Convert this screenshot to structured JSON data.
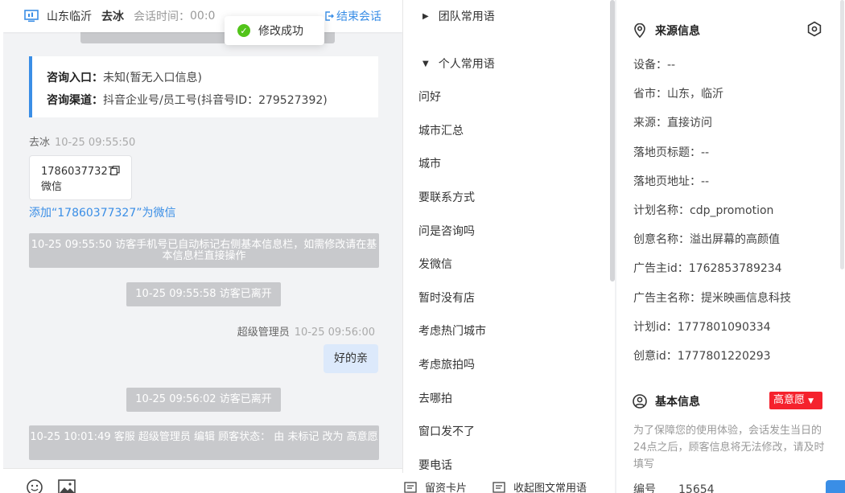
{
  "chat": {
    "header": {
      "location": "山东临沂",
      "visitor_name": "去冰",
      "timer_label": "会话时间：",
      "timer_value": "00:0",
      "end_label": "结束会话"
    },
    "toast": "修改成功",
    "entry_card": {
      "entry_label": "咨询入口：",
      "entry_value": "未知(暂无入口信息)",
      "channel_label": "咨询渠道：",
      "channel_value": "抖音企业号/员工号(抖音号ID：279527392)"
    },
    "message1": {
      "sender": "去冰",
      "time": "10-25 09:55:50",
      "phone": "17860377327",
      "type": "微信",
      "add_link": "添加“17860377327”为微信"
    },
    "system_messages": [
      "10-25 09:55:50 访客手机号已自动标记右侧基本信息栏，如需修改请在基本信息栏直接操作",
      "10-25 09:55:58 访客已离开",
      "10-25 09:56:02 访客已离开",
      "10-25 10:01:49 客服 超级管理员 编辑 顾客状态： 由 未标记 改为 高意愿"
    ],
    "message2": {
      "sender": "超级管理员",
      "time": "10-25 09:56:00",
      "text": "好的亲"
    }
  },
  "phrases": {
    "team_group": "团队常用语",
    "personal_group": "个人常用语",
    "items": [
      "问好",
      "城市汇总",
      "城市",
      "要联系方式",
      "问是咨询吗",
      "发微信",
      "暂时没有店",
      "考虑热门城市",
      "考虑旅拍吗",
      "去哪拍",
      "窗口发不了",
      "要电话"
    ],
    "footer": {
      "card": "留资卡片",
      "collapse": "收起图文常用语"
    }
  },
  "info": {
    "source_title": "来源信息",
    "fields": [
      "设备：--",
      "省市：山东，临沂",
      "来源：直接访问",
      "落地页标题：--",
      "落地页地址：--",
      "计划名称：cdp_promotion",
      "创意名称：溢出屏幕的高颜值",
      "广告主id：1762853789234",
      "广告主名称：提米映画信息科技",
      "计划id：1777801090334",
      "创意id：1777801220293"
    ],
    "basic_title": "基本信息",
    "intent_tag": "高意愿",
    "hint": "为了保障您的使用体验，会话发生当日的24点之后，顾客信息将无法修改，请及时填写",
    "number_label": "编号",
    "number_value": "15654"
  }
}
